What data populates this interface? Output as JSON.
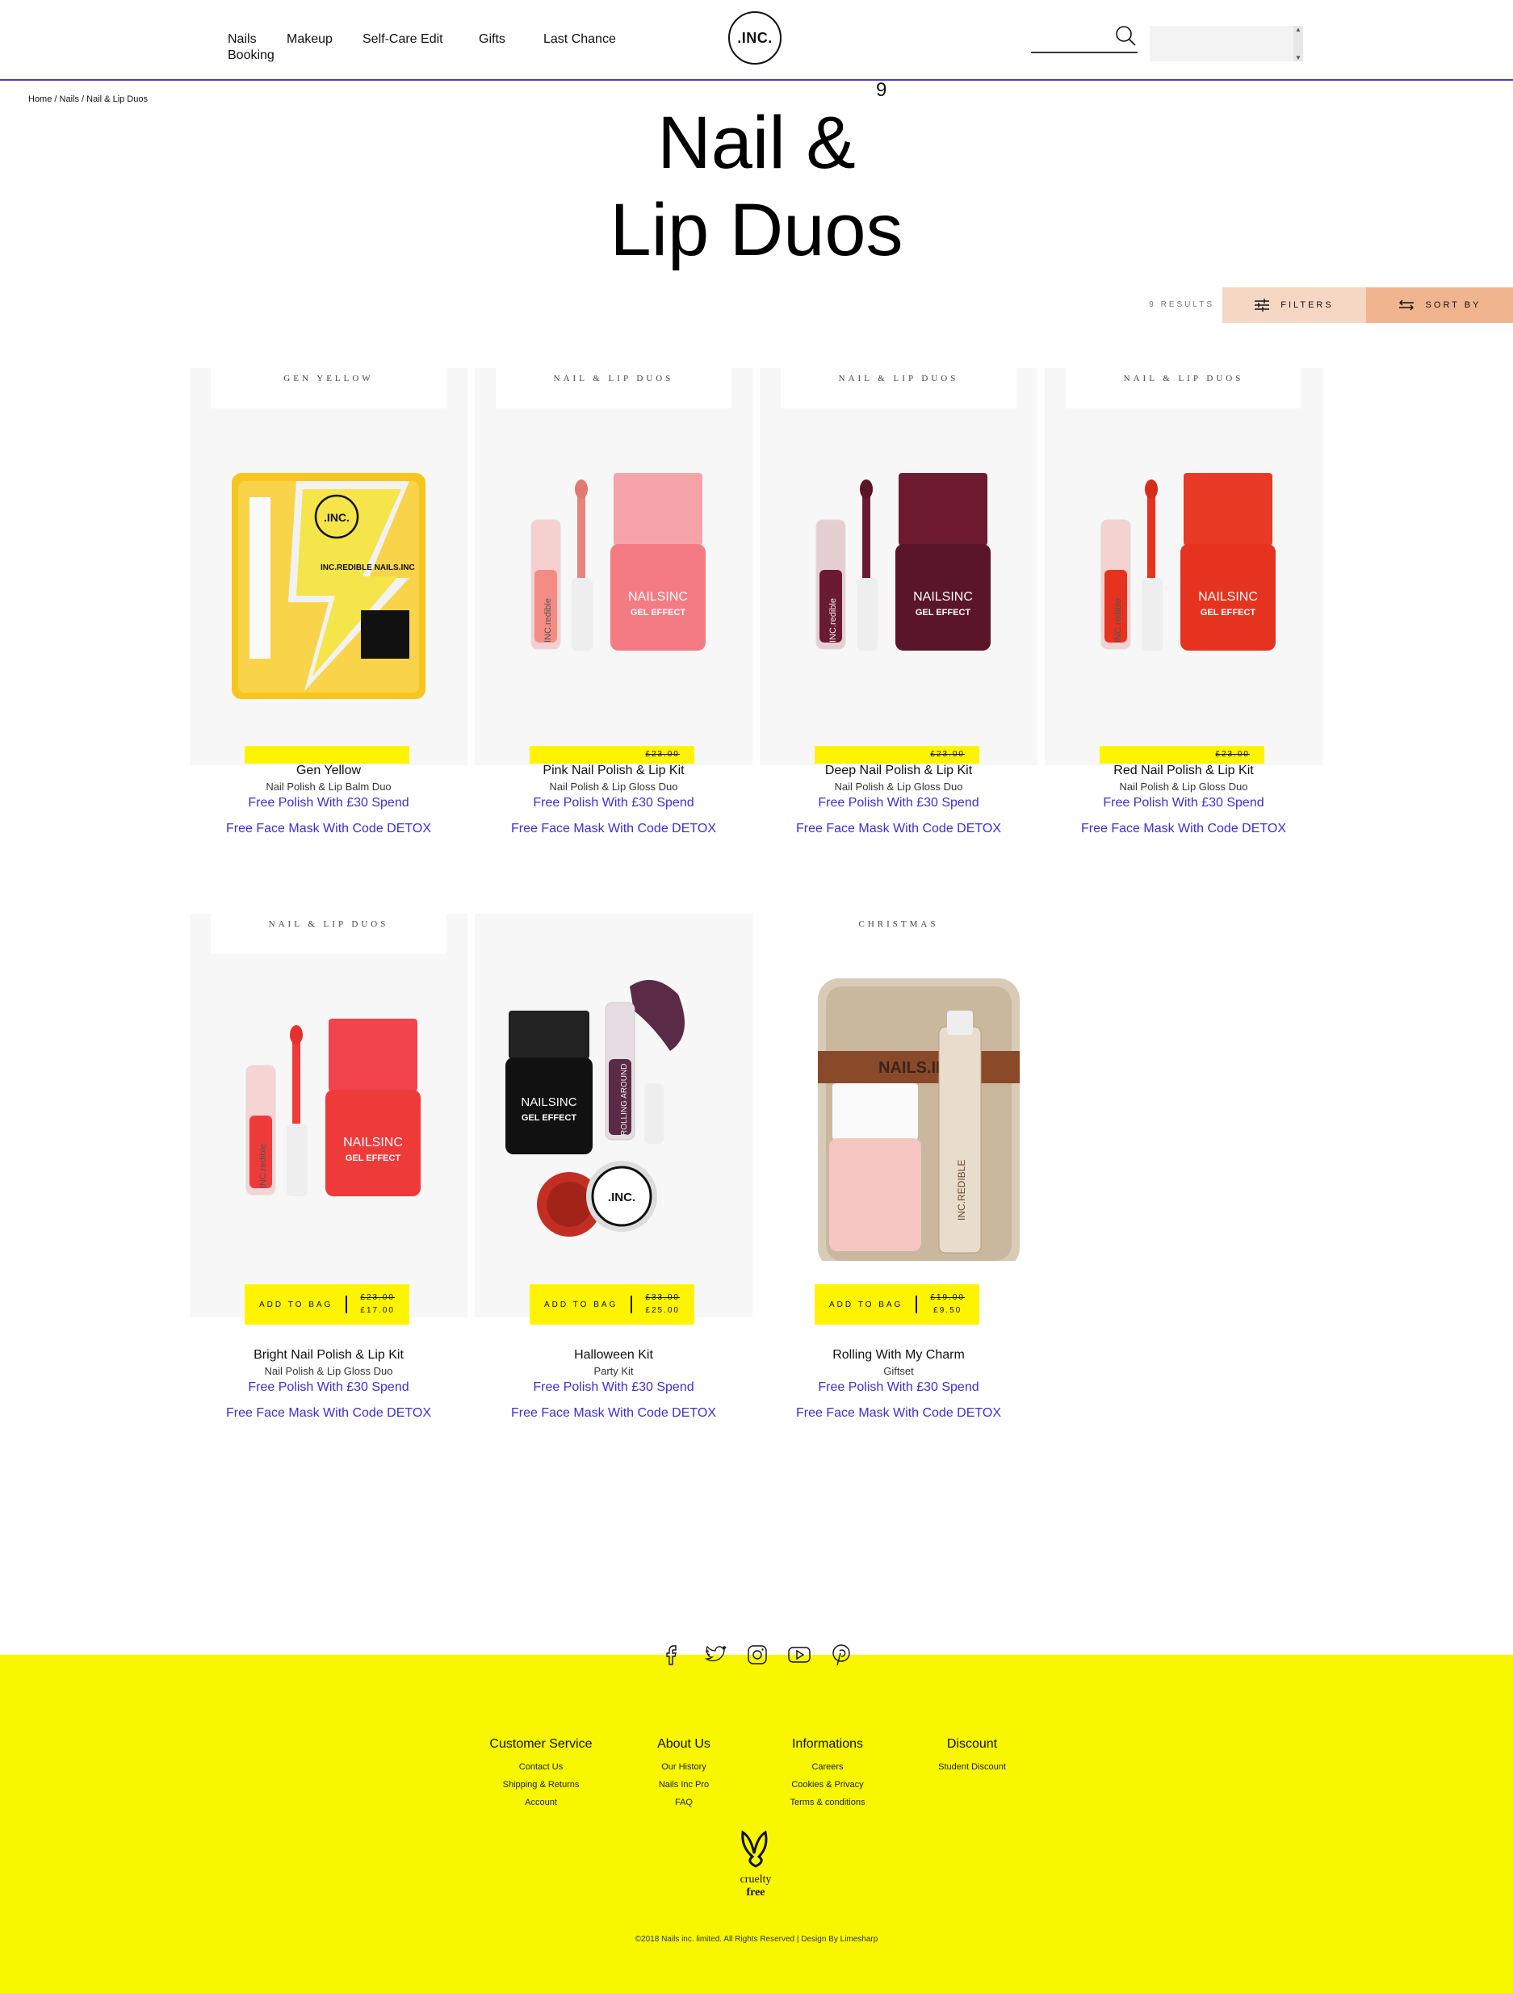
{
  "header": {
    "nav": [
      "Nails",
      "Booking",
      "Makeup",
      "Self-Care Edit",
      "Gifts",
      "Last Chance"
    ],
    "logo_text": ".INC.",
    "search_placeholder": ""
  },
  "breadcrumb": [
    "Home",
    "/",
    "Nails",
    "/",
    "Nail & Lip Duos"
  ],
  "title": {
    "line1": "Nail &",
    "line2": "Lip Duos",
    "count": "9"
  },
  "toolbar": {
    "results": "9 RESULTS",
    "filters": "FILTERS",
    "sort": "SORT BY"
  },
  "products": [
    {
      "tag": "GEN YELLOW",
      "name": "Gen Yellow",
      "sub": "Nail Polish & Lip Balm Duo",
      "promo": "Free Polish With £30 Spend",
      "promo2": "Free Face Mask With Code DETOX",
      "add": "",
      "old_price": "",
      "price": ""
    },
    {
      "tag": "NAIL & LIP DUOS",
      "name": "Pink Nail Polish & Lip Kit",
      "sub": "Nail Polish & Lip Gloss Duo",
      "promo": "Free Polish With £30 Spend",
      "promo2": "Free Face Mask With Code DETOX",
      "add": "",
      "old_price": "£23.00",
      "price": ""
    },
    {
      "tag": "NAIL & LIP DUOS",
      "name": "Deep Nail Polish & Lip Kit",
      "sub": "Nail Polish & Lip Gloss Duo",
      "promo": "Free Polish With £30 Spend",
      "promo2": "Free Face Mask With Code DETOX",
      "add": "",
      "old_price": "£23.00",
      "price": ""
    },
    {
      "tag": "NAIL & LIP DUOS",
      "name": "Red Nail Polish & Lip Kit",
      "sub": "Nail Polish & Lip Gloss Duo",
      "promo": "Free Polish With £30 Spend",
      "promo2": "Free Face Mask With Code DETOX",
      "add": "",
      "old_price": "£23.00",
      "price": ""
    },
    {
      "tag": "NAIL & LIP DUOS",
      "name": "Bright Nail Polish & Lip Kit",
      "sub": "Nail Polish & Lip Gloss Duo",
      "promo": "Free Polish With £30 Spend",
      "promo2": "Free Face Mask With Code DETOX",
      "add": "ADD TO BAG",
      "old_price": "£23.00",
      "price": "£17.00"
    },
    {
      "tag": "",
      "name": "Halloween Kit",
      "sub": "Party Kit",
      "promo": "Free Polish With £30 Spend",
      "promo2": "Free Face Mask With Code DETOX",
      "add": "ADD TO BAG",
      "old_price": "£33.00",
      "price": "£25.00"
    },
    {
      "tag": "CHRISTMAS",
      "name": "Rolling With My Charm",
      "sub": "Giftset",
      "promo": "Free Polish With £30 Spend",
      "promo2": "Free Face Mask With Code DETOX",
      "add": "ADD TO BAG",
      "old_price": "£19.00",
      "price": "£9.50"
    }
  ],
  "product_images": {
    "gen_yellow_box": "INC.REDIBLE NAILS.INC",
    "polish_brand": "NAILSINC",
    "polish_line": "GEL EFFECT",
    "gloss_brand": "INC.redible",
    "gloss_name": "GLAZIN OVER",
    "gloss_name_halloween": "ROLLING AROUND",
    "tin_label": "NAILS.INC",
    "jar_label": ".INC.",
    "spray_label": "INC.REDIBLE"
  },
  "colors": {
    "accent_yellow": "#fff400",
    "footer_yellow": "#f8f700",
    "promo_blue": "#3b2fd6",
    "filters_bg": "#f6d7c4",
    "sort_bg": "#f0b48e",
    "header_rule": "#4a3cc7",
    "pink_polish": "#f47b84",
    "deep_polish": "#5a1528",
    "red_polish": "#e5331f",
    "bright_polish": "#ef3a3a"
  },
  "social_icons": [
    "facebook-icon",
    "twitter-icon",
    "instagram-icon",
    "youtube-icon",
    "pinterest-icon"
  ],
  "footer": {
    "columns": [
      {
        "title": "Customer Service",
        "links": [
          "Contact Us",
          "Shipping & Returns",
          "Account"
        ]
      },
      {
        "title": "About Us",
        "links": [
          "Our History",
          "Nails Inc Pro",
          "FAQ"
        ]
      },
      {
        "title": "Informations",
        "links": [
          "Careers",
          "Cookies & Privacy",
          "Terms & conditions"
        ]
      },
      {
        "title": "Discount",
        "links": [
          "Student Discount"
        ]
      }
    ],
    "cruelty_line1": "cruelty",
    "cruelty_line2": "free",
    "copyright": "©2018 Nails inc. limited. All Rights Reserved | Design By Limesharp"
  }
}
